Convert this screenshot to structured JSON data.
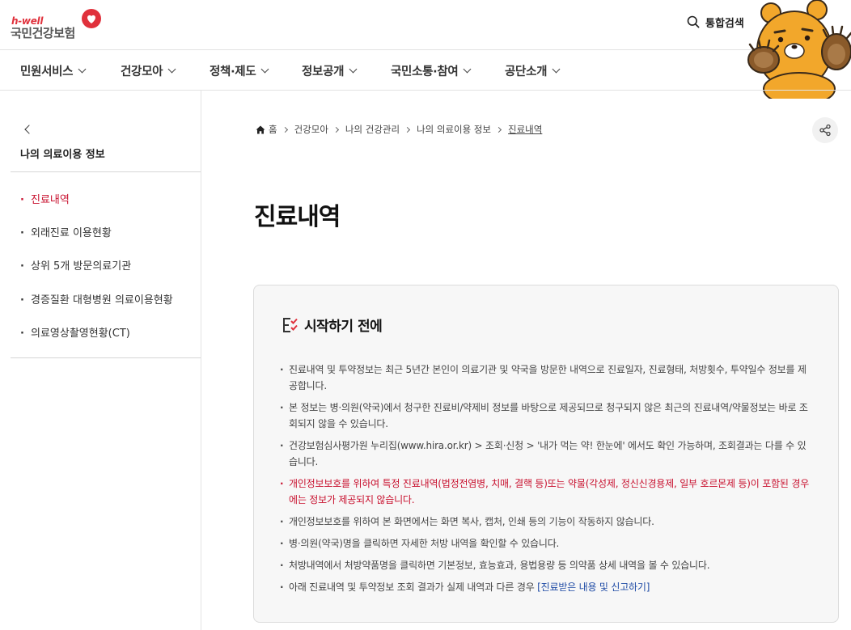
{
  "brand": {
    "hwell": "h-well",
    "name": "국민건강보험",
    "accent_color": "#e0313c",
    "icon": "heart-icon"
  },
  "header": {
    "search_label": "통합검색",
    "search_icon": "search-icon"
  },
  "mascot": {
    "icon": "bear-mascot"
  },
  "gnb": {
    "items": [
      {
        "label": "민원서비스"
      },
      {
        "label": "건강모아"
      },
      {
        "label": "정책·제도"
      },
      {
        "label": "정보공개"
      },
      {
        "label": "국민소통·참여"
      },
      {
        "label": "공단소개"
      }
    ]
  },
  "sidebar": {
    "title": "나의 의료이용 정보",
    "items": [
      {
        "label": "진료내역",
        "active": true
      },
      {
        "label": "외래진료 이용현황"
      },
      {
        "label": "상위 5개 방문의료기관"
      },
      {
        "label": "경증질환 대형병원 의료이용현황"
      },
      {
        "label": "의료영상촬영현황(CT)"
      }
    ]
  },
  "breadcrumb": {
    "home": "홈",
    "items": [
      "건강모아",
      "나의 건강관리",
      "나의 의료이용 정보",
      "진료내역"
    ]
  },
  "page": {
    "title": "진료내역"
  },
  "notice": {
    "title": "시작하기 전에",
    "items": [
      {
        "text": "진료내역 및 투약정보는 최근 5년간 본인이 의료기관 및 약국을 방문한 내역으로 진료일자, 진료형태, 처방횟수, 투약일수 정보를 제공합니다."
      },
      {
        "text": "본 정보는 병·의원(약국)에서 청구한 진료비/약제비 정보를 바탕으로 제공되므로 청구되지 않은 최근의 진료내역/약물정보는 바로 조회되지 않을 수 있습니다."
      },
      {
        "text": "건강보험심사평가원 누리집(www.hira.or.kr) > 조회·신청 > '내가 먹는 약! 한눈에' 에서도 확인 가능하며, 조회결과는 다를 수 있습니다."
      },
      {
        "text": "개인정보보호를 위하여 특정 진료내역(법정전염병, 치매, 결핵 등)또는 약물(각성제, 정신신경용제, 일부 호르몬제 등)이 포함된 경우에는 정보가 제공되지 않습니다.",
        "warning": true
      },
      {
        "text": "개인정보보호를 위하여 본 화면에서는 화면 복사, 캡처, 인쇄 등의 기능이 작동하지 않습니다."
      },
      {
        "text": "병·의원(약국)명을 클릭하면 자세한 처방 내역을 확인할 수 있습니다."
      },
      {
        "text": "처방내역에서 처방약품명을 클릭하면 기본정보, 효능효과, 용법용량 등 의약품 상세 내역을 볼 수 있습니다."
      },
      {
        "text": "아래 진료내역 및 투약정보 조회 결과가 실제 내역과 다른 경우 ",
        "link": "[진료받은 내용 및 신고하기]"
      }
    ]
  },
  "colors": {
    "active": "#c8102e",
    "link": "#1f4ba5",
    "box_bg": "#f7f7f7"
  }
}
